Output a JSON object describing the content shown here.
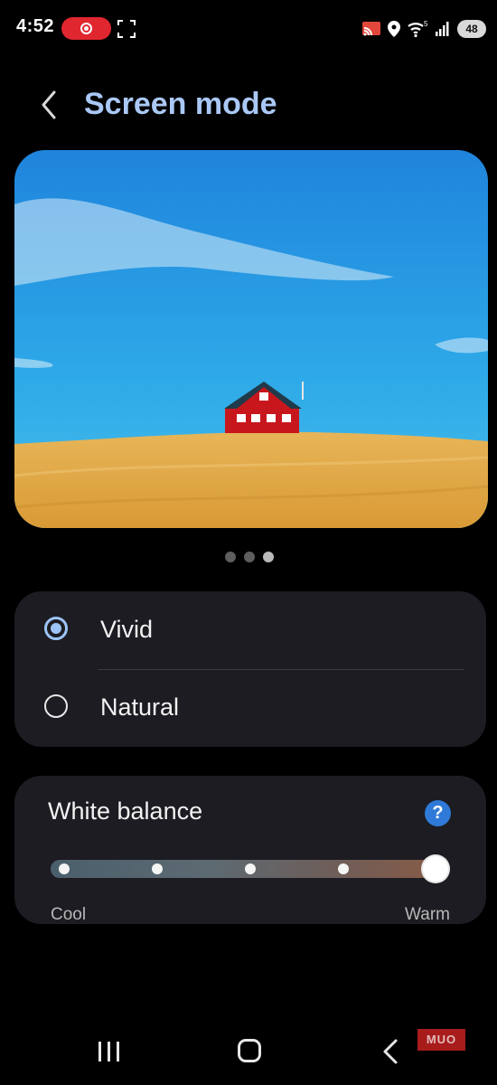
{
  "status_bar": {
    "time": "4:52",
    "battery": "48",
    "icons": [
      "screen-recording-icon",
      "screenshot-capture-icon",
      "cast-icon",
      "location-icon",
      "wifi-icon",
      "signal-icon",
      "battery-icon"
    ]
  },
  "header": {
    "title": "Screen mode",
    "back_icon": "chevron-left-icon"
  },
  "preview": {
    "image_description": "red-house-on-golden-hill-blue-sky",
    "pages": 3,
    "active_page": 3
  },
  "modes": {
    "options": [
      {
        "label": "Vivid",
        "selected": true
      },
      {
        "label": "Natural",
        "selected": false
      }
    ]
  },
  "white_balance": {
    "title": "White balance",
    "help_icon": "?",
    "min_label": "Cool",
    "max_label": "Warm",
    "steps": 5,
    "value_step": 5
  },
  "nav_bar": {
    "icons": [
      "recents-icon",
      "home-icon",
      "back-icon"
    ]
  },
  "watermark": "MUO",
  "colors": {
    "accent": "#aac8f6",
    "card": "#1d1c22",
    "help": "#2f7ad8",
    "record": "#e0262f"
  }
}
